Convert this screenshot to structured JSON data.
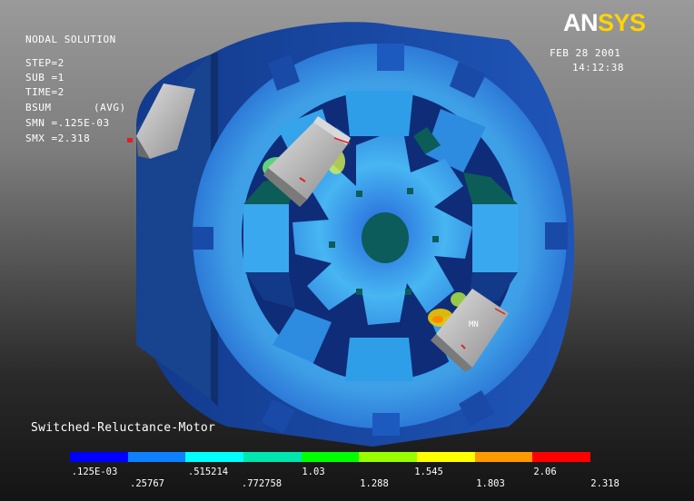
{
  "header": {
    "line1": "NODAL SOLUTION",
    "step": "STEP=2",
    "sub": "SUB =1",
    "time": "TIME=2",
    "quantity": "BSUM",
    "avg": "(AVG)",
    "smn": "SMN =.125E-03",
    "smx": "SMX =2.318"
  },
  "logo": {
    "an": "AN",
    "sys": "SYS"
  },
  "date": "FEB 28 2001",
  "clock": "14:12:38",
  "plot_title": "Switched-Reluctance-Motor",
  "coil_label": "MN",
  "legend": {
    "colors": [
      "#0000ff",
      "#0d80ff",
      "#00ffff",
      "#00e6b0",
      "#00ff00",
      "#99ff00",
      "#ffff00",
      "#ff9900",
      "#ff0000"
    ],
    "labels_top": [
      ".125E-03",
      ".515214",
      "1.03",
      "1.545",
      "2.06"
    ],
    "labels_bottom": [
      ".25767",
      ".772758",
      "1.288",
      "1.803",
      "2.318"
    ]
  },
  "colors": {
    "background_top": "#9a9a9a",
    "background_bottom": "#141414",
    "low_field": "#1c44b8",
    "mid_field": "#2fa8ec",
    "coil": "#b9b9b9"
  }
}
